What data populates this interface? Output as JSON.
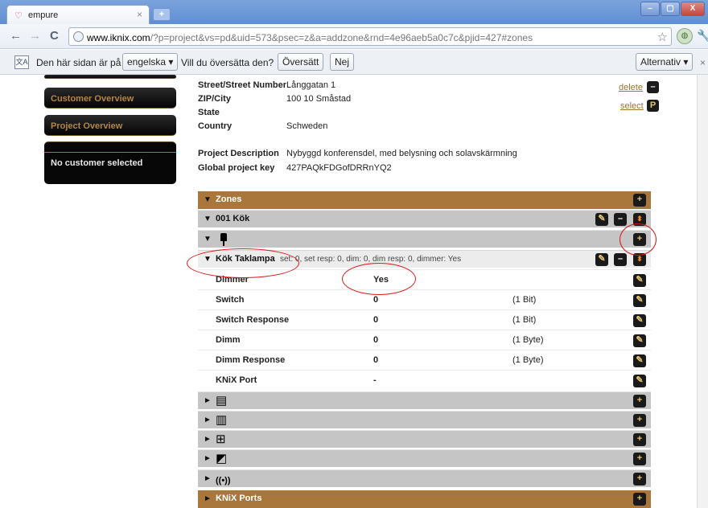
{
  "browser": {
    "tab_title": "empure",
    "tab_close": "×",
    "new_tab": "+",
    "url_host": "www.iknix.com",
    "url_rest": "/?p=project&vs=pd&uid=573&psec=z&a=addzone&rnd=4e96aeb5a0c7c&pjid=427#zones",
    "back_icon": "←",
    "forward_icon": "→",
    "reload_icon": "C",
    "bookmark_icon": "☆",
    "window_min": "–",
    "window_max": "▢",
    "window_close": "X"
  },
  "translate_bar": {
    "prefix": "Den här sidan är på",
    "language": "engelska ▾",
    "question": "Vill du översätta den?",
    "translate_button": "Översätt",
    "no_button": "Nej",
    "options_button": "Alternativ ▾",
    "close_icon": "×"
  },
  "sidebar": {
    "customer_overview": "Customer Overview",
    "project_overview": "Project Overview",
    "no_customer": "No customer selected"
  },
  "project_info": {
    "fields": [
      {
        "label": "Street/Street Number",
        "value": "Långgatan 1"
      },
      {
        "label": "ZIP/City",
        "value": "100 10 Småstad"
      },
      {
        "label": "State",
        "value": ""
      },
      {
        "label": "Country",
        "value": "Schweden"
      },
      {
        "label": "Project Description",
        "value": "Nybyggd konferensdel, med belysning och solavskärmning"
      },
      {
        "label": "Global project key",
        "value": "427PAQkFDGofDRRnYQ2"
      }
    ],
    "delete_link": "delete",
    "select_link": "select",
    "select_icon": "P",
    "delete_icon": "–"
  },
  "zones": {
    "header": "Zones",
    "zone_name": "001 Kök",
    "device_name": "Kök Taklampa",
    "device_meta": "set: 0, set resp: 0, dim: 0, dim resp: 0, dimmer: Yes",
    "properties": [
      {
        "name": "Dimmer",
        "value": "Yes",
        "size": ""
      },
      {
        "name": "Switch",
        "value": "0",
        "size": "(1 Bit)"
      },
      {
        "name": "Switch Response",
        "value": "0",
        "size": "(1 Bit)"
      },
      {
        "name": "Dimm",
        "value": "0",
        "size": "(1 Byte)"
      },
      {
        "name": "Dimm Response",
        "value": "0",
        "size": "(1 Byte)"
      },
      {
        "name": "KNiX Port",
        "value": "-",
        "size": ""
      }
    ],
    "categories": [
      {
        "icon": "blinds-icon",
        "glyph": "▤"
      },
      {
        "icon": "radiator-icon",
        "glyph": "▥"
      },
      {
        "icon": "computers-icon",
        "glyph": "⊞"
      },
      {
        "icon": "devices-icon",
        "glyph": "◩"
      },
      {
        "icon": "wireless-icon",
        "glyph": "((•))"
      }
    ],
    "knix_ports": "KNiX Ports",
    "expanded_arrow": "▼",
    "collapsed_arrow": "►",
    "plus": "+",
    "minus": "–",
    "edit": "✎",
    "move": "⬍"
  }
}
